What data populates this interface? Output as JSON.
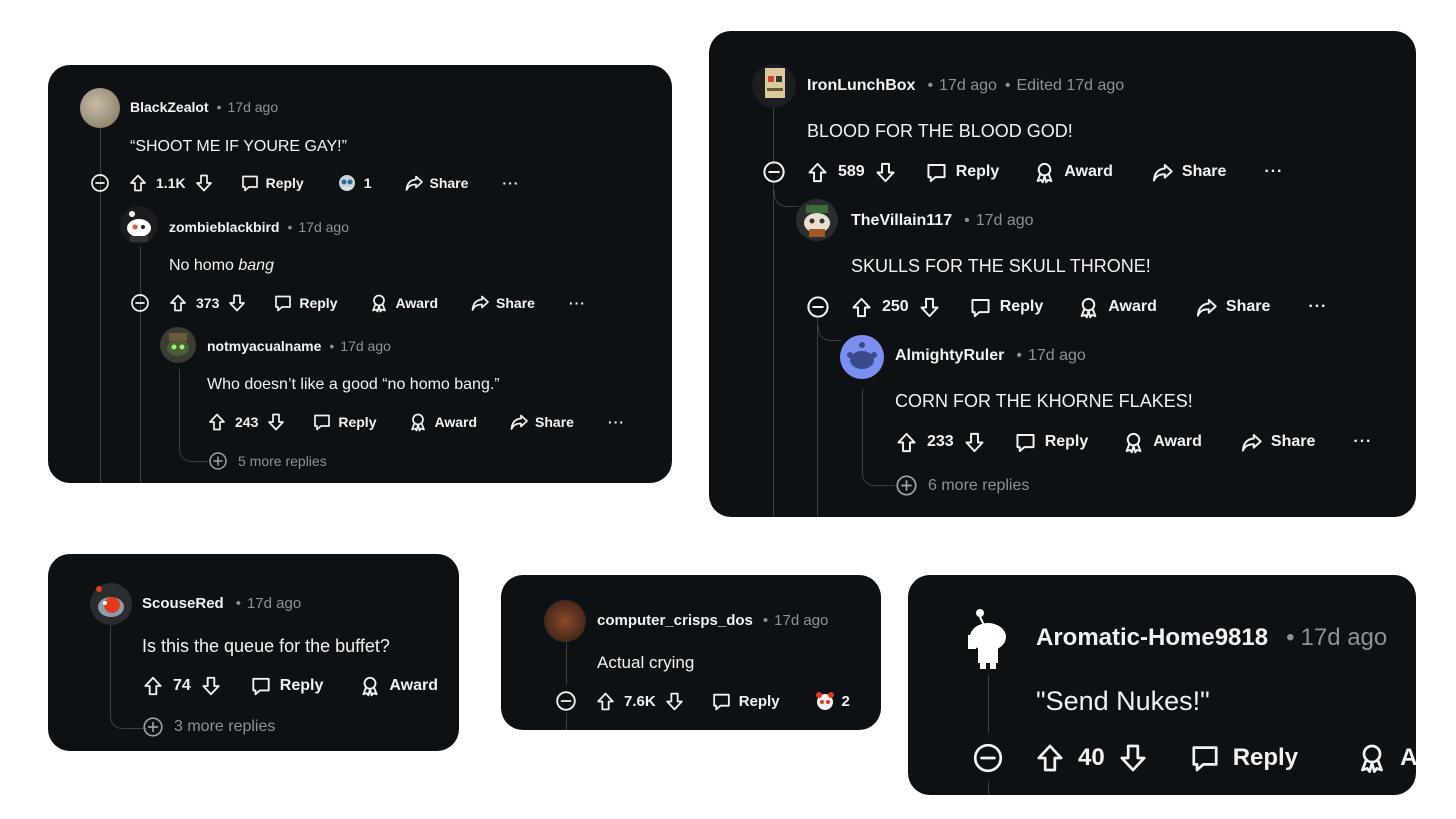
{
  "cards": {
    "c1": {
      "comments": [
        {
          "user": "BlackZealot",
          "time": "17d ago",
          "text": "“SHOOT ME IF YOURE GAY!”",
          "votes": "1.1K",
          "reply": "Reply",
          "award_count": "1",
          "share": "Share",
          "more_actions": "···"
        },
        {
          "user": "zombieblackbird",
          "time": "17d ago",
          "text_plain": "No homo ",
          "text_em": "bang",
          "votes": "373",
          "reply": "Reply",
          "award": "Award",
          "share": "Share",
          "more_actions": "···"
        },
        {
          "user": "notmyacualname",
          "time": "17d ago",
          "text": "Who doesn’t like a good “no homo bang.”",
          "votes": "243",
          "reply": "Reply",
          "award": "Award",
          "share": "Share",
          "more_actions": "···"
        }
      ],
      "more_replies": "5 more replies"
    },
    "c2": {
      "comments": [
        {
          "user": "IronLunchBox",
          "time": "17d ago",
          "edited": "Edited 17d ago",
          "text": "BLOOD FOR THE BLOOD GOD!",
          "votes": "589",
          "reply": "Reply",
          "award": "Award",
          "share": "Share",
          "more_actions": "···"
        },
        {
          "user": "TheVillain117",
          "time": "17d ago",
          "text": "SKULLS FOR THE SKULL THRONE!",
          "votes": "250",
          "reply": "Reply",
          "award": "Award",
          "share": "Share",
          "more_actions": "···"
        },
        {
          "user": "AlmightyRuler",
          "time": "17d ago",
          "text": "CORN FOR THE KHORNE FLAKES!",
          "votes": "233",
          "reply": "Reply",
          "award": "Award",
          "share": "Share",
          "more_actions": "···"
        }
      ],
      "more_replies": "6 more replies"
    },
    "c3": {
      "comment": {
        "user": "ScouseRed",
        "time": "17d ago",
        "text": "Is this the queue for the buffet?",
        "votes": "74",
        "reply": "Reply",
        "award": "Award"
      },
      "more_replies": "3 more replies"
    },
    "c4": {
      "comment": {
        "user": "computer_crisps_dos",
        "time": "17d ago",
        "text": "Actual crying",
        "votes": "7.6K",
        "reply": "Reply",
        "award_count": "2"
      }
    },
    "c5": {
      "comment": {
        "user": "Aromatic-Home9818",
        "time": "17d ago",
        "text": "\"Send Nukes!\"",
        "votes": "40",
        "reply": "Reply",
        "award": "A"
      }
    }
  },
  "colors": {
    "card_bg": "#0e1113",
    "text": "#f2f2f2",
    "meta": "#8a939a",
    "thread_line": "#3a3f44",
    "snoo_blue": "#7b8ff0"
  },
  "icons": [
    "collapse-icon",
    "upvote-icon",
    "downvote-icon",
    "reply-icon",
    "award-icon",
    "share-icon",
    "expand-icon",
    "snoo-avatar-icon"
  ]
}
